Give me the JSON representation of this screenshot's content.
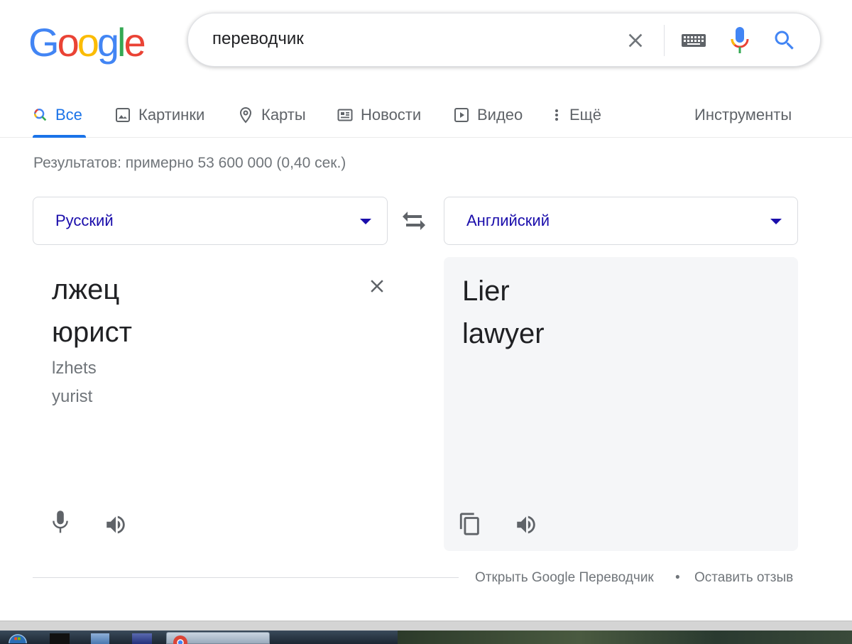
{
  "logo": {
    "letters": [
      "G",
      "o",
      "o",
      "g",
      "l",
      "e"
    ],
    "colors": [
      "#4285F4",
      "#EA4335",
      "#FBBC05",
      "#4285F4",
      "#34A853",
      "#EA4335"
    ]
  },
  "search": {
    "query": "переводчик"
  },
  "tabs": [
    {
      "label": "Все",
      "icon": "search-icon",
      "active": true
    },
    {
      "label": "Картинки",
      "icon": "image-icon"
    },
    {
      "label": "Карты",
      "icon": "map-pin-icon"
    },
    {
      "label": "Новости",
      "icon": "news-icon"
    },
    {
      "label": "Видео",
      "icon": "play-icon"
    },
    {
      "label": "Ещё",
      "icon": "more-vert-icon"
    }
  ],
  "tools_label": "Инструменты",
  "result_stats": "Результатов: примерно 53 600 000 (0,40 сек.)",
  "translator": {
    "source_lang": "Русский",
    "target_lang": "Английский",
    "source_lines": [
      "лжец",
      "юрист"
    ],
    "transliteration": [
      "lzhets",
      "yurist"
    ],
    "target_lines": [
      "Lier",
      "lawyer"
    ]
  },
  "footer": {
    "open_link": "Открыть Google Переводчик",
    "separator": "•",
    "feedback_link": "Оставить отзыв"
  },
  "colors": {
    "accent": "#1a73e8",
    "link": "#1a0dab"
  }
}
